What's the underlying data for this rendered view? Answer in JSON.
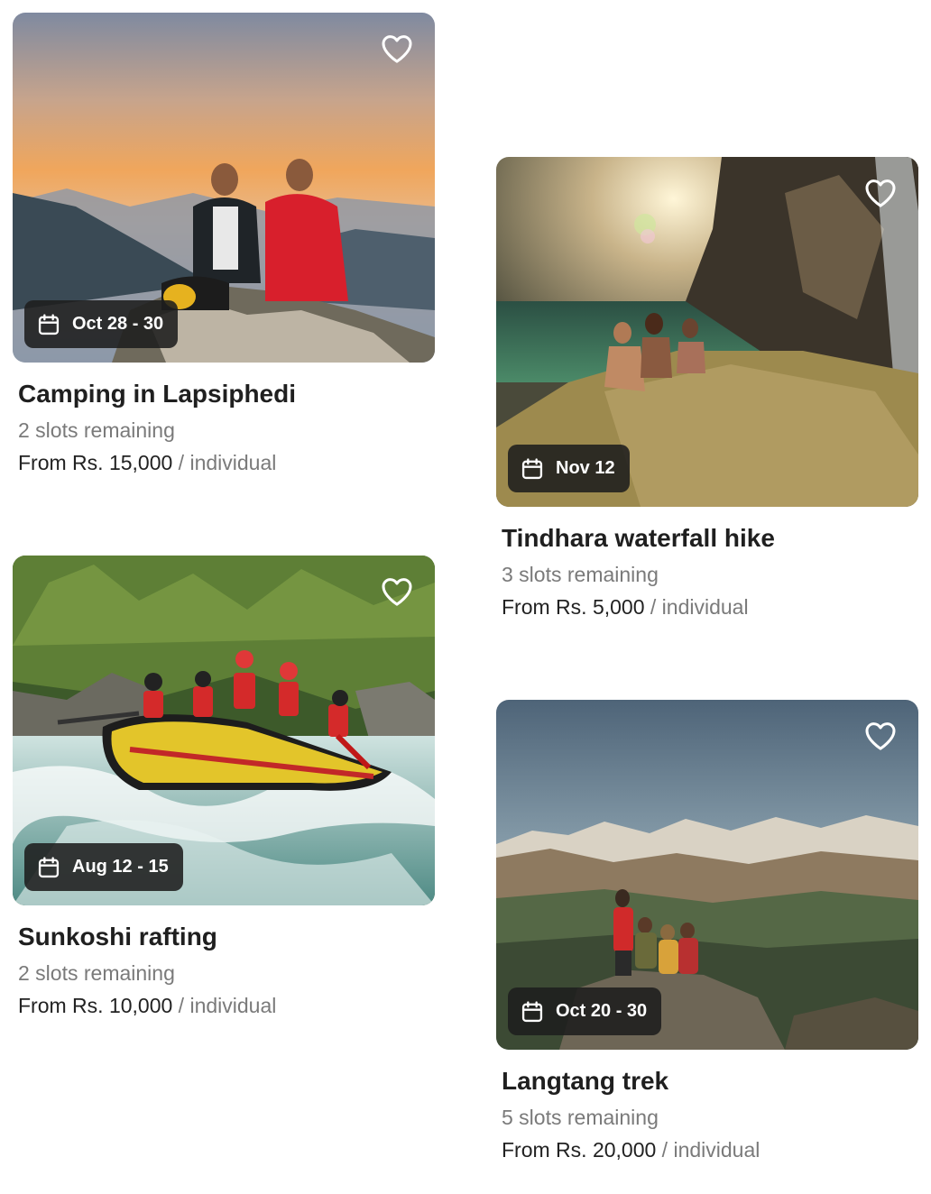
{
  "cards": [
    {
      "title": "Camping in Lapsiphedi",
      "date": "Oct 28 - 30",
      "slots": "2 slots remaining",
      "price": "From Rs. 15,000",
      "unit": " / individual"
    },
    {
      "title": "Tindhara waterfall hike",
      "date": "Nov 12",
      "slots": "3 slots remaining",
      "price": "From Rs. 5,000",
      "unit": " / individual"
    },
    {
      "title": "Sunkoshi rafting",
      "date": "Aug 12 - 15",
      "slots": "2 slots remaining",
      "price": "From Rs. 10,000",
      "unit": " / individual"
    },
    {
      "title": "Langtang trek",
      "date": "Oct 20 - 30",
      "slots": "5 slots remaining",
      "price": "From Rs. 20,000",
      "unit": " / individual"
    }
  ],
  "icons": {
    "favorite": "heart-outline-icon",
    "date": "calendar-icon"
  }
}
